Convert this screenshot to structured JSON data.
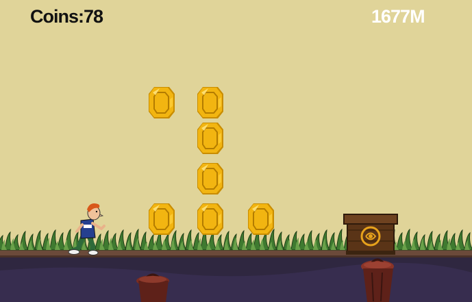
{
  "hud": {
    "coins_text": "Coins:78",
    "distance_text": "1677M"
  },
  "colors": {
    "sky": "#e0d499",
    "coin": "#f2b511",
    "coin_dark": "#c98d00",
    "grass": "#3f7a30",
    "dirt": "#6b4a3a",
    "underground": "#2e2540",
    "crate": "#6a3f1d",
    "trash_can": "#6b2a20"
  },
  "icons": [
    "coin-icon",
    "runner-character",
    "wooden-crate-obstacle",
    "trash-can-obstacle"
  ],
  "coins_shown": 7
}
